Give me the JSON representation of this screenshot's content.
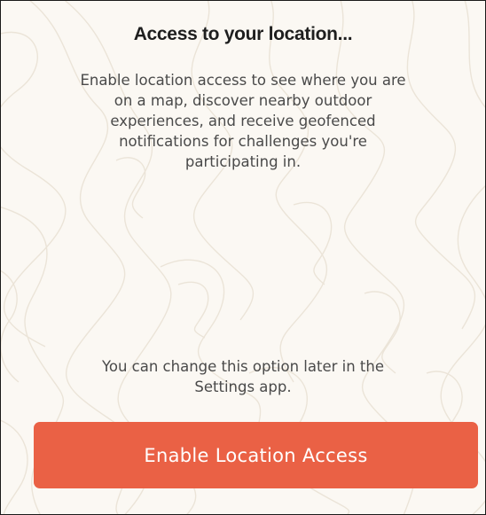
{
  "dialog": {
    "title": "Access to your location...",
    "description": "Enable location access to see where you are on a map, discover nearby outdoor experiences, and receive geofenced notifications for challenges you're participating in.",
    "note": "You can change this option later in the Settings app.",
    "primary_button_label": "Enable Location Access"
  },
  "colors": {
    "background": "#fbf8f3",
    "topo_lines": "#ebe4d8",
    "accent": "#ea6145",
    "title_text": "#1e1e1e",
    "body_text": "#4a4a4a"
  },
  "background_pattern": "topographic-contour-lines"
}
